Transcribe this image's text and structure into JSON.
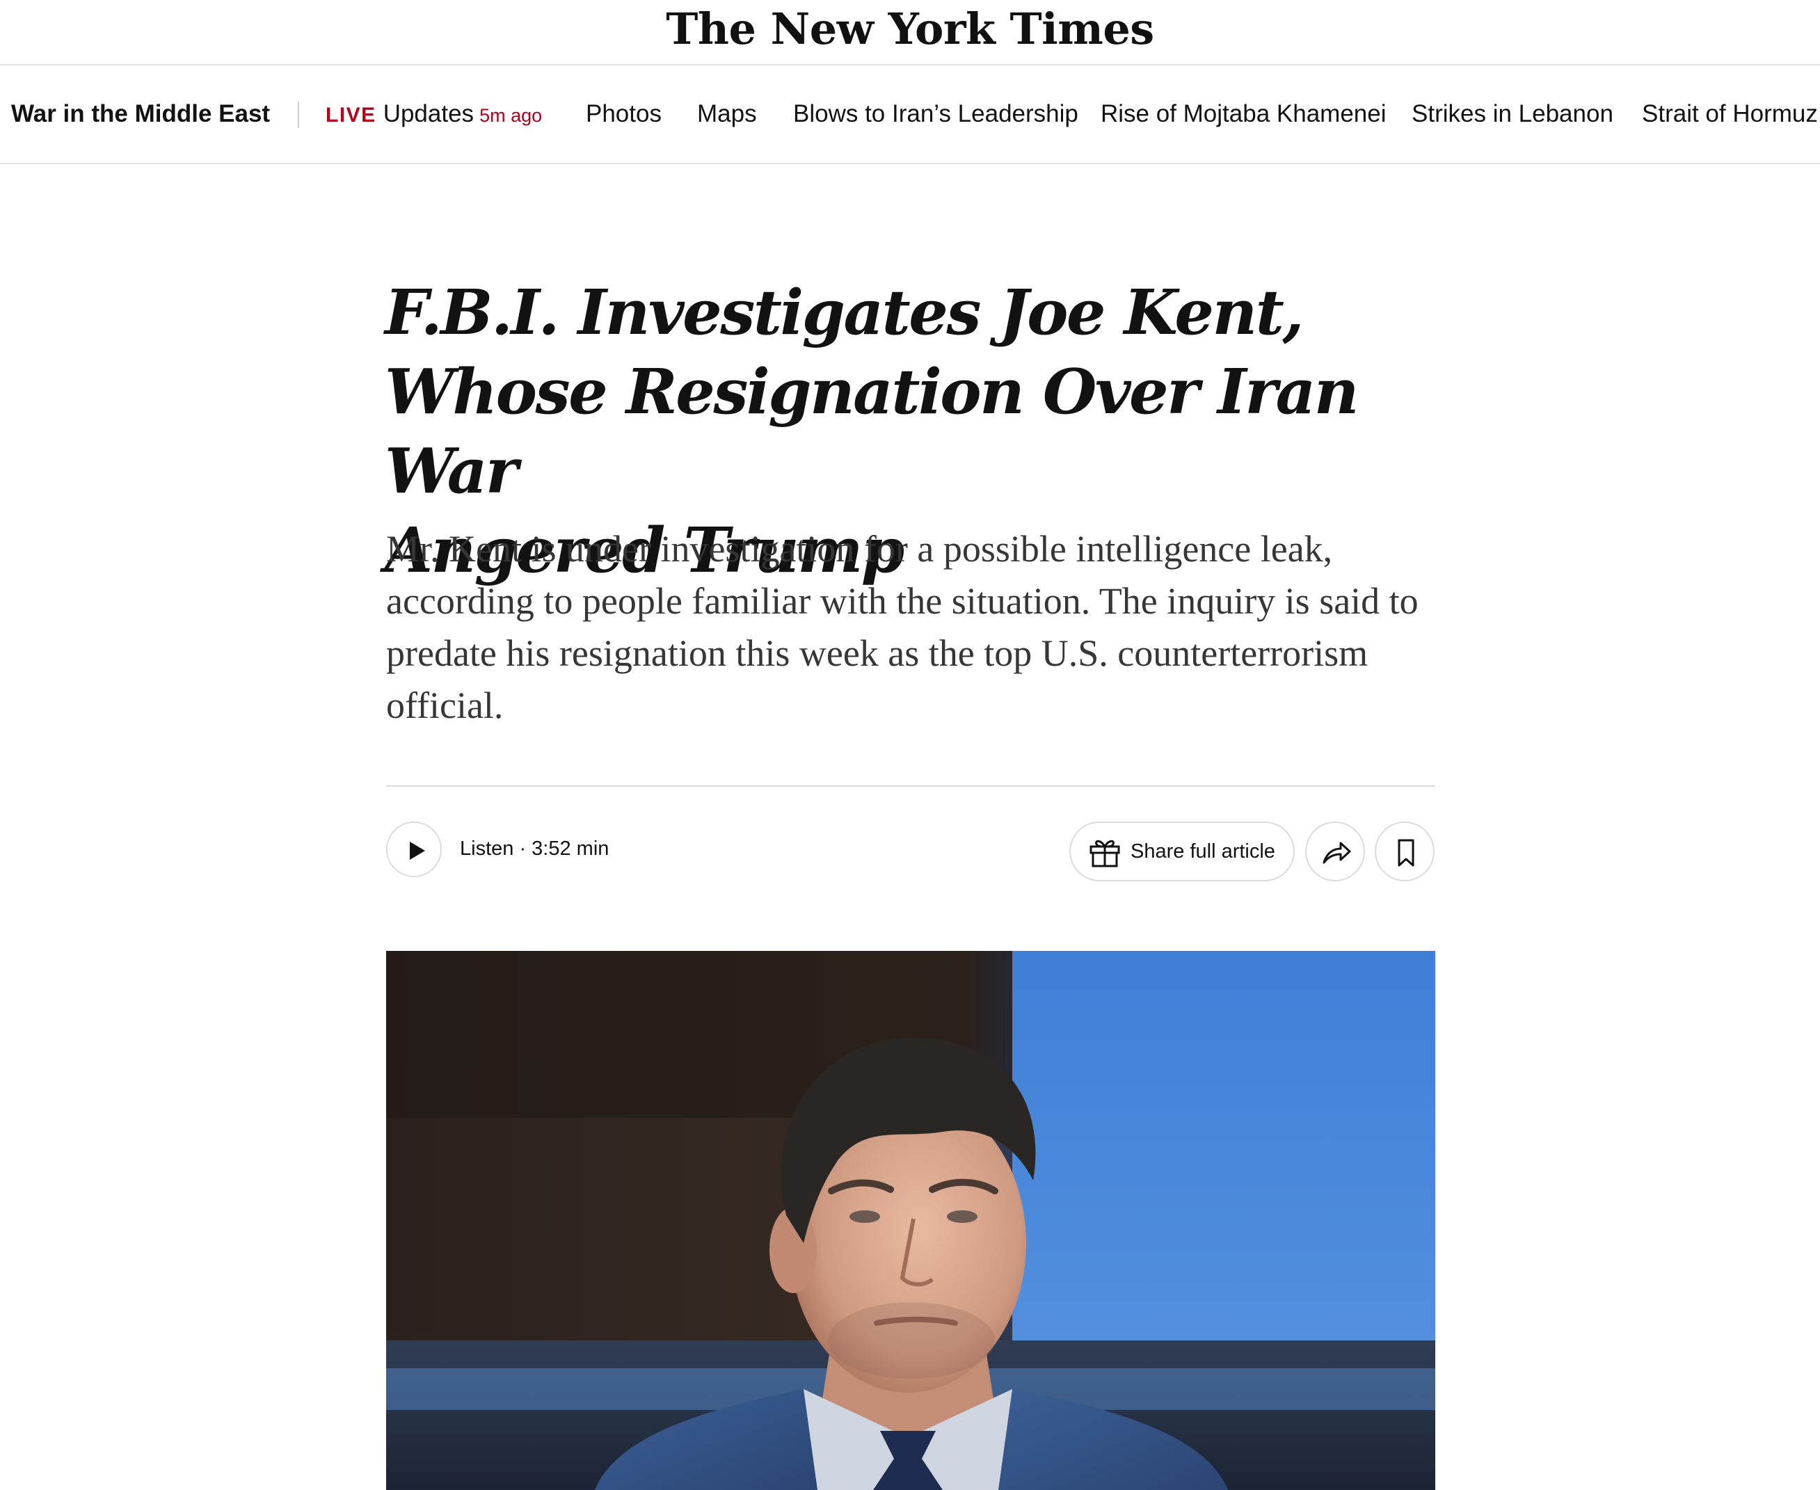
{
  "masthead": {
    "logo_text": "The New York Times"
  },
  "section_nav": {
    "section_title": "War in the Middle East",
    "live": {
      "label": "LIVE",
      "text": "Updates",
      "ago": "5m ago"
    },
    "links": [
      {
        "label": "Photos"
      },
      {
        "label": "Maps"
      },
      {
        "label": "Blows to Iran’s Leadership"
      },
      {
        "label": "Rise of Mojtaba Khamenei"
      },
      {
        "label": "Strikes in Lebanon"
      },
      {
        "label": "Strait of Hormuz"
      }
    ]
  },
  "article": {
    "headline_lines": [
      "F.B.I. Investigates Joe Kent,",
      "Whose Resignation Over Iran War",
      "Angered Trump"
    ],
    "summary": "Mr. Kent is under investigation for a possible intelligence leak, according to people familiar with the situation. The inquiry is said to predate his resignation this week as the top U.S. counterterrorism official."
  },
  "actions": {
    "listen_label": "Listen · 3:52 min",
    "share_full_label": "Share full article",
    "icons": {
      "play": "play-icon",
      "gift": "gift-icon",
      "share": "share-arrow-icon",
      "save": "bookmark-icon"
    }
  },
  "lead_image": {
    "subject": "photo-portrait"
  },
  "colors": {
    "live_red": "#b3001b",
    "divider": "#e2e2e2",
    "text": "#121212",
    "summary_text": "#363636"
  }
}
